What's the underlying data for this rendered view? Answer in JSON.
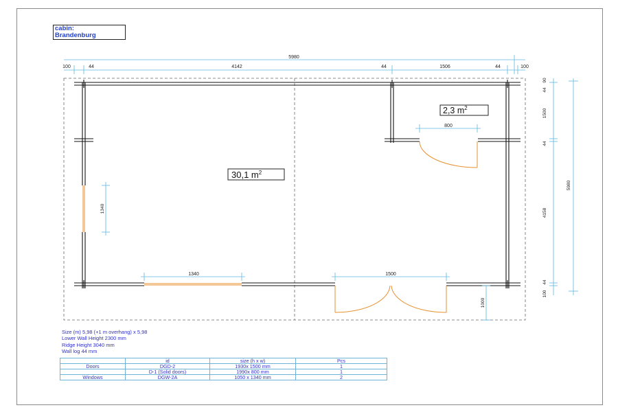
{
  "title": {
    "line1": "cabin:",
    "line2": "Brandenburg"
  },
  "dimensions": {
    "overall_width": "5980",
    "left_overhang": "100",
    "left_log": "44",
    "main_room_width": "4142",
    "mid_log": "44",
    "small_room_width": "1506",
    "right_log": "44",
    "right_overhang": "100",
    "right_top_overhang": "90",
    "right_log_a": "44",
    "small_room_depth": "1500",
    "right_log_b": "44",
    "main_depth": "4158",
    "right_log_c": "44",
    "right_bottom_overhang": "100",
    "overall_depth": "5980",
    "small_door_width": "800",
    "front_window_width": "1340",
    "side_window_width": "1340",
    "double_door_width": "1500",
    "terrace_depth": "1000"
  },
  "areas": {
    "main_room": {
      "value": "30,1 m",
      "sup": "2"
    },
    "small_room": {
      "value": "2,3 m",
      "sup": "2"
    }
  },
  "specs": [
    "Size (m) 5,98 (+1 m overhang)   x  5,98",
    "Lower Wall Height  2300 mm",
    "Ridge Height  3040 mm",
    "Wall log 44 mm"
  ],
  "parts_table": {
    "headers": [
      "",
      "id",
      "size (h x w)",
      "Pcs"
    ],
    "rows": [
      [
        "Doors",
        "DGD-2",
        "1930x 1500 mm",
        "1"
      ],
      [
        "",
        "D-1 (Solid doors)",
        "1990x 800 mm",
        "1"
      ],
      [
        "Windows",
        "DGW-2A",
        "1050 x 1340 mm",
        "2"
      ]
    ]
  },
  "colors": {
    "wall": "#111111",
    "door_window": "#e8902e",
    "dimension_line": "#5fb8e0",
    "dashed_outline": "#666666",
    "spec_text": "#2f2fc8"
  }
}
